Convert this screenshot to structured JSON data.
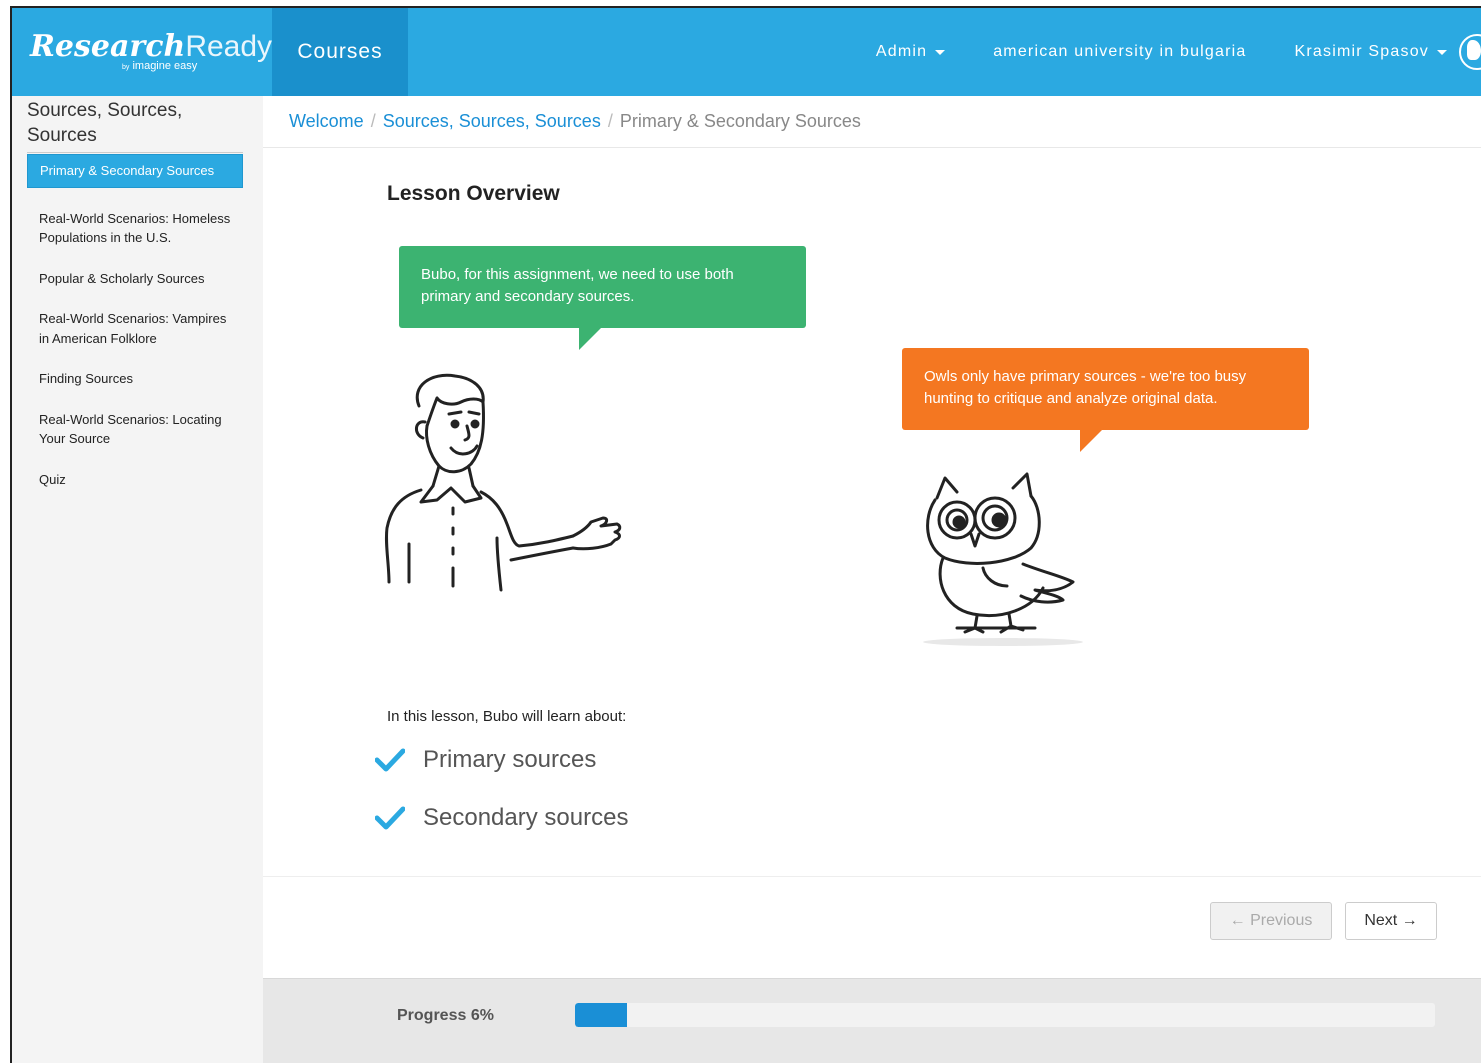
{
  "header": {
    "logo_main": "Research",
    "logo_ready": "Ready",
    "logo_tm": "™",
    "logo_by": "by",
    "logo_sub": "imagine easy",
    "courses_label": "Courses",
    "admin_label": "Admin",
    "institution_label": "american university in bulgaria",
    "user_label": "Krasimir Spasov",
    "brand_color": "#2ba9e1"
  },
  "sidebar": {
    "heading": "Sources, Sources, Sources",
    "items": [
      {
        "label": "Primary & Secondary Sources",
        "active": true
      },
      {
        "label": "Real-World Scenarios: Homeless Populations in the U.S.",
        "active": false
      },
      {
        "label": "Popular & Scholarly Sources",
        "active": false
      },
      {
        "label": "Real-World Scenarios: Vampires in American Folklore",
        "active": false
      },
      {
        "label": "Finding Sources",
        "active": false
      },
      {
        "label": "Real-World Scenarios: Locating Your Source",
        "active": false
      },
      {
        "label": "Quiz",
        "active": false
      }
    ]
  },
  "breadcrumb": {
    "home": "Welcome",
    "section": "Sources, Sources, Sources",
    "current": "Primary & Secondary Sources",
    "separator": "/"
  },
  "lesson": {
    "title": "Lesson Overview",
    "bubble_person": "Bubo, for this assignment, we need to use both primary and secondary sources.",
    "bubble_owl": "Owls only have primary sources - we're too busy hunting to critique and analyze original data.",
    "intro": "In this lesson, Bubo will learn about:",
    "topics": [
      "Primary sources",
      "Secondary sources"
    ],
    "bubble_person_color": "#3cb371",
    "bubble_owl_color": "#f47721"
  },
  "navigation": {
    "previous_label": "← Previous",
    "next_label": "Next →"
  },
  "progress": {
    "label": "Progress 6%",
    "percent": 6
  }
}
